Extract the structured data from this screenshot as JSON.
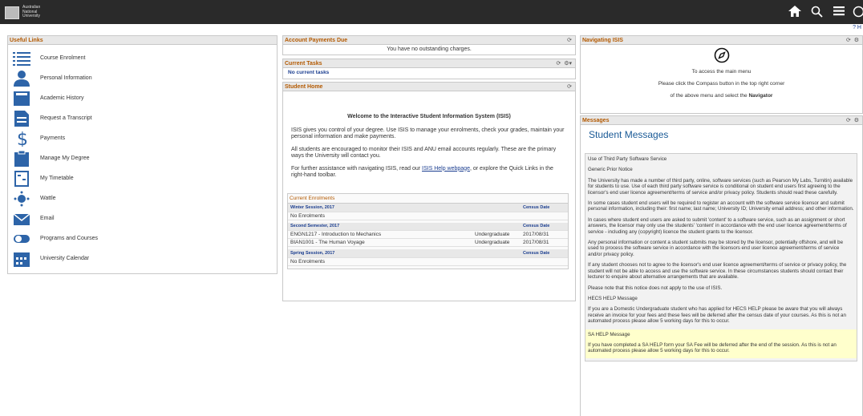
{
  "header": {
    "logo_text": [
      "Australian",
      "National",
      "University"
    ],
    "icons": [
      "home-icon",
      "search-icon",
      "menu-icon",
      "compass-icon"
    ],
    "help_label": "? H"
  },
  "useful_links": {
    "title": "Useful Links",
    "items": [
      {
        "label": "Course Enrolment",
        "icon": "list-icon"
      },
      {
        "label": "Personal Information",
        "icon": "person-icon"
      },
      {
        "label": "Academic History",
        "icon": "book-icon"
      },
      {
        "label": "Request a Transcript",
        "icon": "document-icon"
      },
      {
        "label": "Payments",
        "icon": "dollar-icon"
      },
      {
        "label": "Manage My Degree",
        "icon": "clipboard-icon"
      },
      {
        "label": "My Timetable",
        "icon": "timetable-icon"
      },
      {
        "label": "Wattle",
        "icon": "wattle-icon"
      },
      {
        "label": "Email",
        "icon": "email-icon"
      },
      {
        "label": "Programs and Courses",
        "icon": "toggle-icon"
      },
      {
        "label": "University Calendar",
        "icon": "calendar-icon"
      }
    ]
  },
  "account_payments": {
    "title": "Account Payments Due",
    "message": "You have no outstanding charges."
  },
  "current_tasks": {
    "title": "Current Tasks",
    "message": "No current tasks"
  },
  "student_home": {
    "title": "Student Home",
    "heading": "Welcome to the Interactive Student Information System (ISIS)",
    "p1": "ISIS gives you control of your degree. Use ISIS to manage your enrolments, check your grades, maintain your personal information and make payments.",
    "p2": "All students are encouraged to monitor their ISIS and ANU email accounts regularly. These are the primary ways the University will contact you.",
    "p3_before": "For further assistance with navigating ISIS, read our ",
    "p3_link": "ISIS Help webpage",
    "p3_after": ", or explore the Quick Links in the right-hand toolbar."
  },
  "current_enrolments": {
    "title": "Current Enrolments",
    "census_label": "Census Date",
    "sessions": [
      {
        "name": "Winter Session, 2017",
        "rows": [
          {
            "course": "No Enrolments",
            "type": "",
            "date": ""
          }
        ]
      },
      {
        "name": "Second Semester, 2017",
        "rows": [
          {
            "course": "ENGN1217 - Introduction to Mechanics",
            "type": "Undergraduate",
            "date": "2017/08/31"
          },
          {
            "course": "BIAN1001 - The Human Voyage",
            "type": "Undergraduate",
            "date": "2017/08/31"
          }
        ]
      },
      {
        "name": "Spring Session, 2017",
        "rows": [
          {
            "course": "No Enrolments",
            "type": "",
            "date": ""
          }
        ]
      }
    ]
  },
  "navigating": {
    "title": "Navigating ISIS",
    "line1": "To access the main menu",
    "line2": "Please click the Compass button in the top right corner",
    "line3_before": "of the above menu and select the ",
    "line3_bold": "Navigator"
  },
  "messages": {
    "title": "Messages",
    "heading": "Student Messages",
    "third_party_title": "Use of Third Party Software Service",
    "generic": "Generic Prior Notice",
    "p1": "The University has made a number of third party, online, software services (such as Pearson My Labs, Turnitin) available for students to use. Use of each third party software service is conditional on student end users first agreeing to the licensor's end user licence agreement/terms of service and/or privacy policy. Students should read these carefully.",
    "p2": "In some cases student end users will be required to register an account with the software service licensor and submit personal information, including their: first name; last name; University ID; University email address; and other information.",
    "p3": "In cases where student end users are asked to submit 'content' to a software service, such as an assignment or short answers, the licensor may only use the students' 'content' in accordance with the end user licence agreement/terms of service - including any (copyright) licence the student grants to the licensor.",
    "p4": "Any personal information or content a student submits may be stored by the licensor, potentially offshore, and will be used to process the software service in accordance with the licensors end user licence agreement/terms of service and/or privacy policy.",
    "p5": "If any student chooses not to agree to the licensor's end user licence agreement/terms of service or privacy policy, the student will not be able to access and use the software service. In these circumstances students should contact their lecturer to enquire about alternative arrangements that are available.",
    "p6": "Please note that this notice does not apply to the use of ISIS.",
    "hecs_title": "HECS HELP Message",
    "hecs": "If you are a Domestic Undergraduate student who has applied for HECS HELP please be aware that you will always receive an invoice for your fees and these fees will be deferred after the census date of your courses. As this is not an automated process please allow 5 working days for this to occur.",
    "sa_title": "SA HELP Message",
    "sa": "If you have completed a SA HELP form your SA Fee will be deferred after the end of the session. As this is not an automated process please allow 5 working days for this to occur."
  },
  "colors": {
    "accent": "#b35900",
    "link": "#1a3d8f",
    "topbar": "#2a2a2a",
    "icon": "#2d64a8"
  }
}
